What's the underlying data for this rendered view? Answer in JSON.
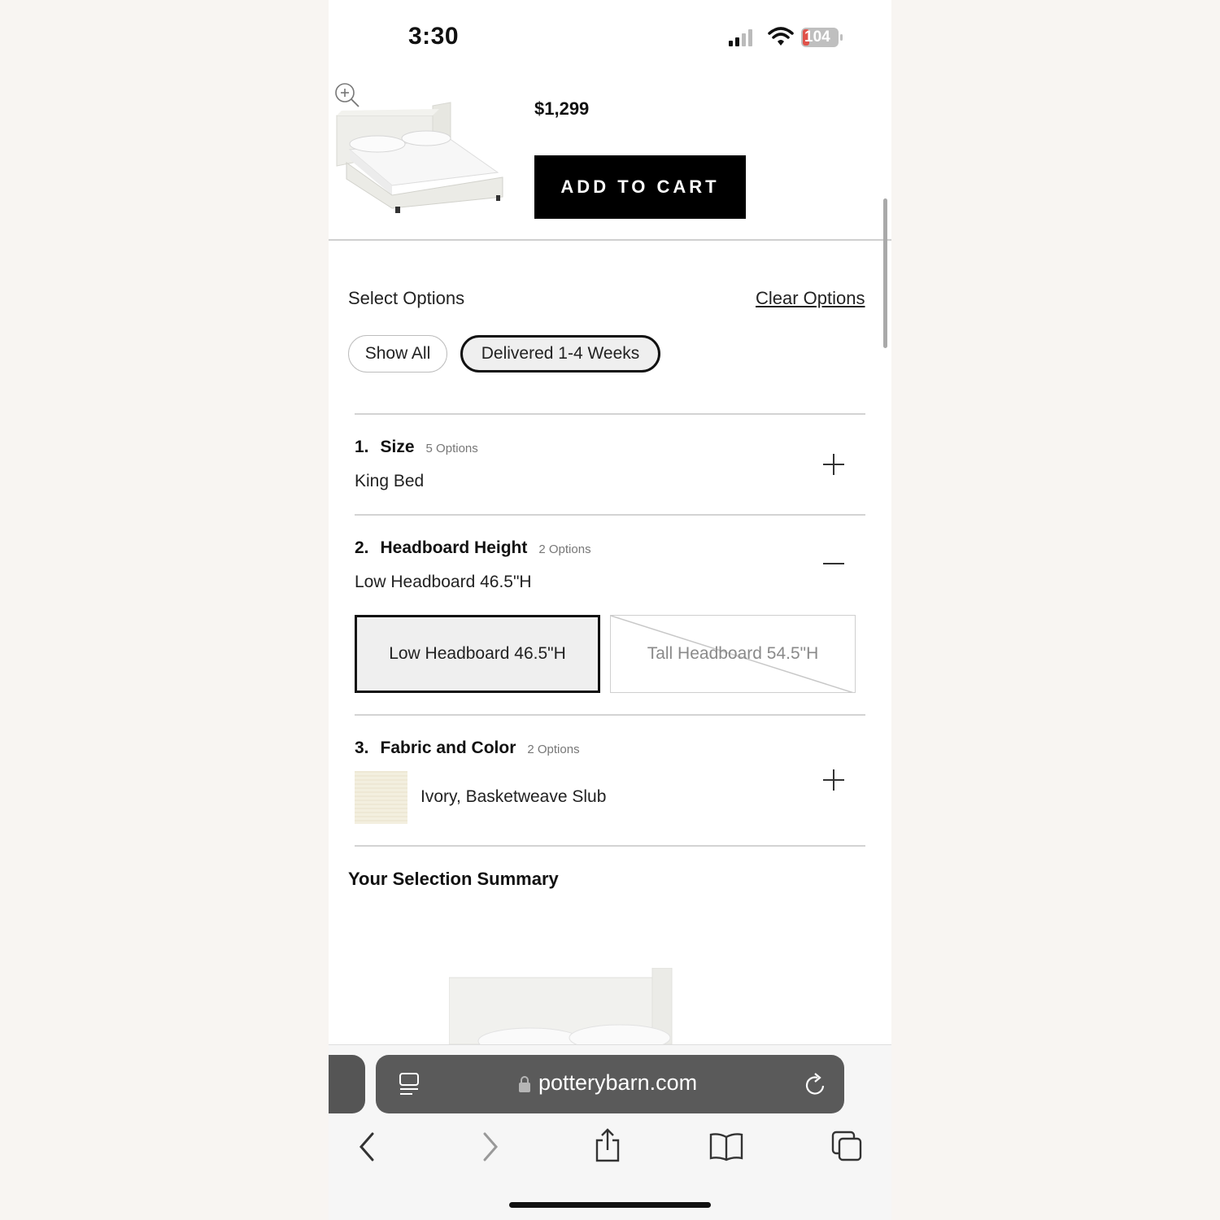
{
  "status_bar": {
    "time": "3:30",
    "battery": "104"
  },
  "product": {
    "price": "$1,299",
    "add_to_cart_label": "ADD TO CART"
  },
  "options": {
    "heading": "Select Options",
    "clear_label": "Clear Options",
    "filters": [
      {
        "label": "Show All",
        "selected": false
      },
      {
        "label": "Delivered 1-4 Weeks",
        "selected": true
      }
    ],
    "sections": [
      {
        "number": "1.",
        "title": "Size",
        "count": "5 Options",
        "value": "King Bed",
        "expanded": false
      },
      {
        "number": "2.",
        "title": "Headboard Height",
        "count": "2 Options",
        "value": "Low Headboard 46.5\"H",
        "expanded": true,
        "choices": [
          {
            "label": "Low Headboard 46.5\"H",
            "selected": true,
            "available": true
          },
          {
            "label": "Tall Headboard 54.5\"H",
            "selected": false,
            "available": false
          }
        ]
      },
      {
        "number": "3.",
        "title": "Fabric and Color",
        "count": "2 Options",
        "value": "Ivory, Basketweave Slub",
        "expanded": false
      }
    ]
  },
  "summary": {
    "title": "Your Selection Summary"
  },
  "browser": {
    "url": "potterybarn.com"
  },
  "colors": {
    "background": "#f8f5f2",
    "button": "#000000",
    "address_bar": "#5a5a5a",
    "battery_fill": "#e0524a"
  }
}
